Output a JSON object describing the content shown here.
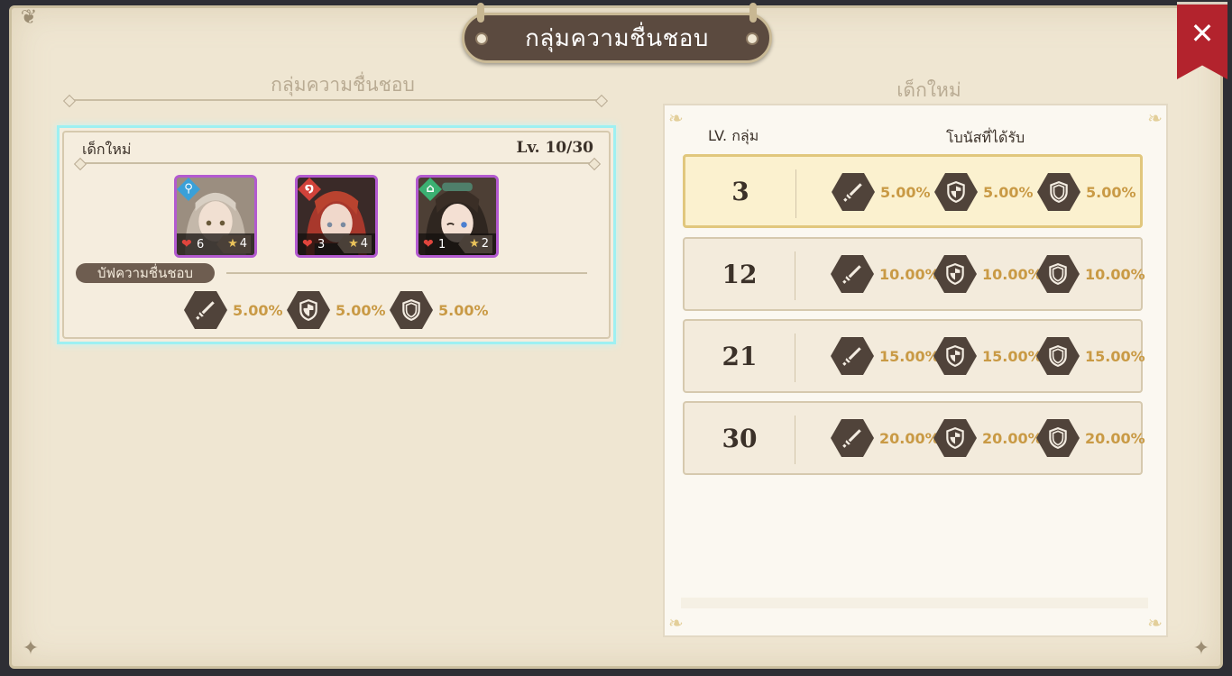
{
  "title": "กลุ่มความชื่นชอบ",
  "close_label": "✕",
  "left": {
    "header": "กลุ่มความชื่นชอบ",
    "group": {
      "name": "เด็กใหม่",
      "level_text": "Lv. 10/30",
      "characters": [
        {
          "element_color": "#3aa0d8",
          "element_icon": "⚲",
          "affection": "6",
          "stars": "4"
        },
        {
          "element_color": "#d1423a",
          "element_icon": "໑",
          "affection": "3",
          "stars": "4"
        },
        {
          "element_color": "#3bb072",
          "element_icon": "⌂",
          "affection": "1",
          "stars": "2"
        }
      ],
      "buff_label": "บัฟความชื่นชอบ",
      "buffs": [
        {
          "icon": "sword-icon",
          "value": "5.00%"
        },
        {
          "icon": "shield-cross-icon",
          "value": "5.00%"
        },
        {
          "icon": "shield-icon",
          "value": "5.00%"
        }
      ]
    }
  },
  "right": {
    "header": "เด็กใหม่",
    "col_level": "LV. กลุ่ม",
    "col_bonus": "โบนัสที่ได้รับ",
    "rows": [
      {
        "level": "3",
        "values": [
          "5.00%",
          "5.00%",
          "5.00%"
        ],
        "active": true
      },
      {
        "level": "12",
        "values": [
          "10.00%",
          "10.00%",
          "10.00%"
        ],
        "active": false
      },
      {
        "level": "21",
        "values": [
          "15.00%",
          "15.00%",
          "15.00%"
        ],
        "active": false
      },
      {
        "level": "30",
        "values": [
          "20.00%",
          "20.00%",
          "20.00%"
        ],
        "active": false
      }
    ]
  },
  "colors": {
    "accent_gold": "#c99a45",
    "hex_dark": "#50433a",
    "close_red": "#b3232d",
    "selection_cyan": "#9ef0f2"
  }
}
